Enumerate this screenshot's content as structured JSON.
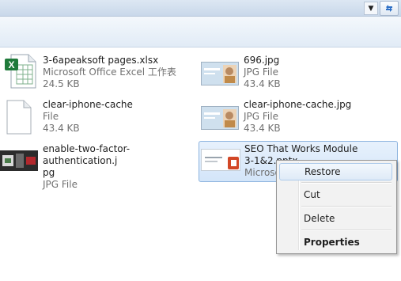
{
  "files": [
    {
      "name": "3-6apeaksoft pages.xlsx",
      "type": "Microsoft Office Excel 工作表",
      "size": "24.5 KB",
      "icon": "excel-file-icon"
    },
    {
      "name": "696.jpg",
      "type": "JPG File",
      "size": "43.4 KB",
      "icon": "jpg-thumbnail-icon"
    },
    {
      "name": "clear-iphone-cache",
      "type": "File",
      "size": "43.4 KB",
      "icon": "blank-file-icon"
    },
    {
      "name": "clear-iphone-cache.jpg",
      "type": "JPG File",
      "size": "43.4 KB",
      "icon": "jpg-thumbnail-icon"
    },
    {
      "name": "enable-two-factor-authentication.j\npg",
      "type": "JPG File",
      "icon": "jpg-thumbnail-icon"
    },
    {
      "name": "SEO That Works Module\n3-1&2.pptx",
      "type": "Microsoft",
      "icon": "pptx-thumbnail-icon"
    }
  ],
  "context_menu": {
    "items": [
      "Restore",
      "Cut",
      "Delete",
      "Properties"
    ],
    "highlighted": "Restore"
  },
  "colors": {
    "selection": "#d3e5f9",
    "excel": "#1f7a3a",
    "powerpoint": "#d24726"
  }
}
